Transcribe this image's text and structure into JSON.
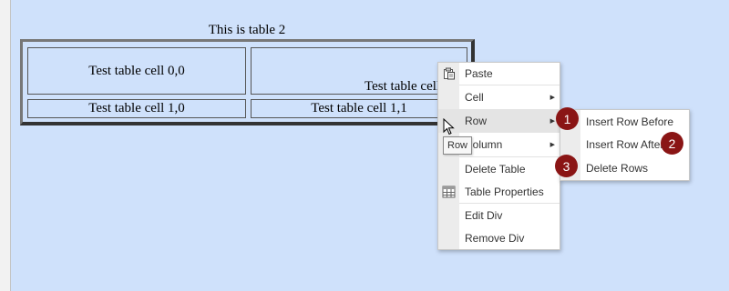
{
  "table": {
    "caption": "This is table 2",
    "cell_0_0": "Test table cell 0,0",
    "cell_0_1": "Test table cell 0,1",
    "cell_1_0": "Test table cell 1,0",
    "cell_1_1": "Test table cell 1,1"
  },
  "context_menu": {
    "items": [
      {
        "label": "Paste",
        "icon": "paste-icon"
      },
      {
        "label": "Cell",
        "submenu": true
      },
      {
        "label": "Row",
        "submenu": true,
        "highlighted": true
      },
      {
        "label": "Column",
        "submenu": true
      },
      {
        "label": "Delete Table"
      },
      {
        "label": "Table Properties",
        "icon": "table-grid-icon"
      },
      {
        "label": "Edit Div"
      },
      {
        "label": "Remove Div"
      }
    ]
  },
  "row_submenu": {
    "items": [
      {
        "label": "Insert Row Before"
      },
      {
        "label": "Insert Row After"
      },
      {
        "label": "Delete Rows"
      }
    ]
  },
  "tooltip": {
    "text": "Row"
  },
  "badges": {
    "one": "1",
    "two": "2",
    "three": "3"
  },
  "colors": {
    "page_background": "#cfe1fb",
    "badge": "#8a1515",
    "menu_highlight": "#e4e4e4"
  }
}
